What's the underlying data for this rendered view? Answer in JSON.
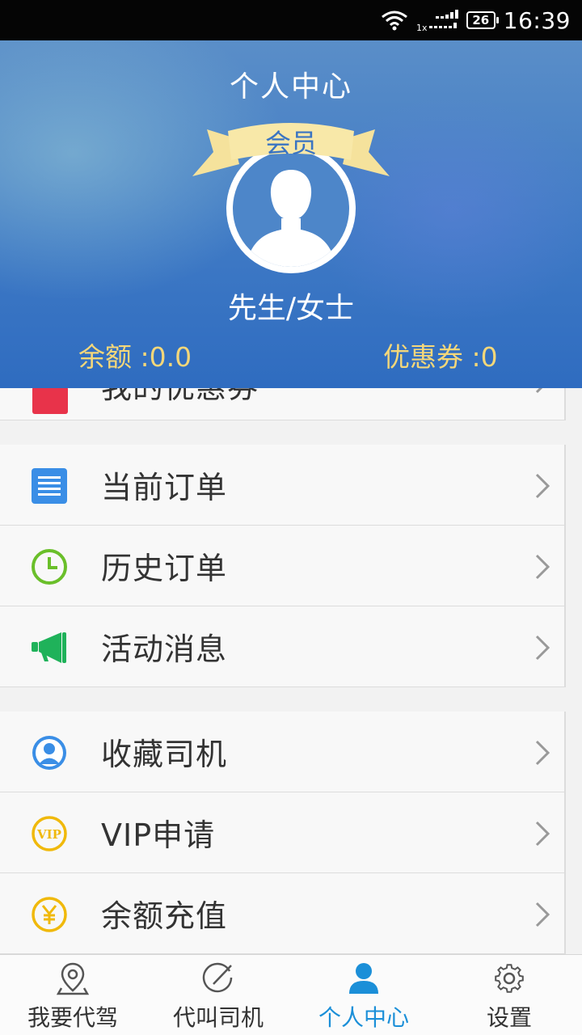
{
  "status_bar": {
    "network_label": "1x",
    "battery": "26",
    "time": "16:39"
  },
  "header": {
    "title": "个人中心",
    "badge": "会员",
    "username": "先生/女士",
    "balance": "余额  :0.0",
    "coupon": "优惠券  :0"
  },
  "menu": {
    "partial_item": {
      "label": "我的优惠券",
      "icon": "coupon-icon",
      "color": "#e8334a"
    },
    "group1": [
      {
        "label": "当前订单",
        "icon": "document-icon",
        "color": "#3a8ee6"
      },
      {
        "label": "历史订单",
        "icon": "clock-icon",
        "color": "#6abf2a"
      },
      {
        "label": "活动消息",
        "icon": "megaphone-icon",
        "color": "#1fb25a"
      }
    ],
    "group2": [
      {
        "label": "收藏司机",
        "icon": "user-circle-icon",
        "color": "#3a8ee6"
      },
      {
        "label": "VIP申请",
        "icon": "vip-icon",
        "color": "#f0b90b"
      },
      {
        "label": "余额充值",
        "icon": "yuan-icon",
        "color": "#f0b90b"
      }
    ]
  },
  "bottom_nav": [
    {
      "label": "我要代驾",
      "icon": "location-pin-icon",
      "active": false
    },
    {
      "label": "代叫司机",
      "icon": "compass-icon",
      "active": false
    },
    {
      "label": "个人中心",
      "icon": "person-icon",
      "active": true
    },
    {
      "label": "设置",
      "icon": "gear-icon",
      "active": false
    }
  ],
  "colors": {
    "header_blue": "#3f7ac5",
    "gold": "#f4d77a",
    "nav_active": "#1b8fd8"
  }
}
